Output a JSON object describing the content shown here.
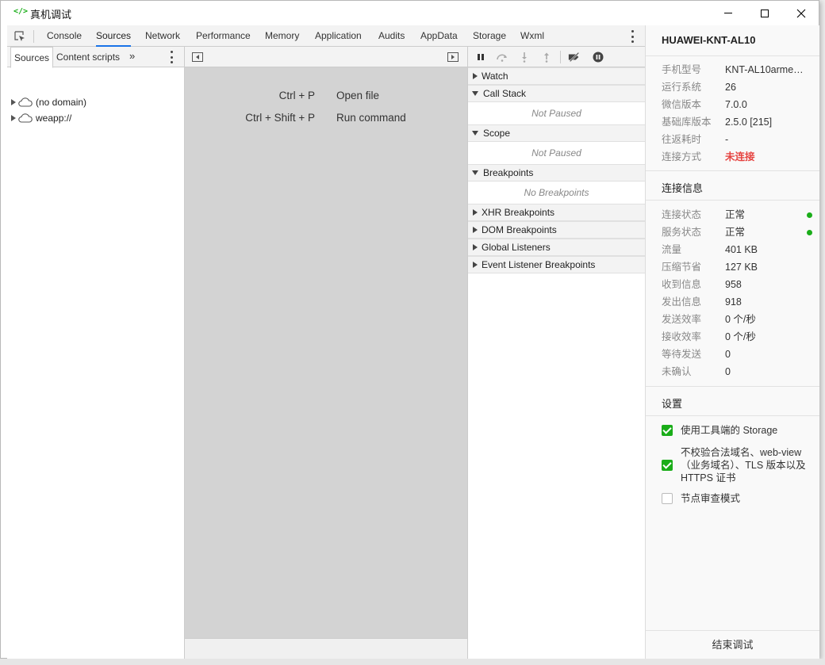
{
  "window": {
    "icon": "</>",
    "title": "真机调试",
    "icon_color": "#1aad19"
  },
  "tabs": [
    {
      "label": "Console"
    },
    {
      "label": "Sources",
      "active": true
    },
    {
      "label": "Network"
    },
    {
      "label": "Performance"
    },
    {
      "label": "Memory"
    },
    {
      "label": "Application"
    },
    {
      "label": "Audits"
    },
    {
      "label": "AppData"
    },
    {
      "label": "Storage"
    },
    {
      "label": "Wxml"
    }
  ],
  "navigator": {
    "tabs": [
      {
        "label": "Sources",
        "active": true
      },
      {
        "label": "Content scripts"
      }
    ],
    "more": "»",
    "tree": [
      {
        "label": "(no domain)",
        "icon": "cloud-icon"
      },
      {
        "label": "weapp://",
        "icon": "cloud-icon"
      }
    ]
  },
  "editor": {
    "shortcuts": [
      {
        "keys": "Ctrl + P",
        "action": "Open file"
      },
      {
        "keys": "Ctrl + Shift + P",
        "action": "Run command"
      }
    ]
  },
  "debugger": {
    "sections": [
      {
        "label": "Watch",
        "expanded": false
      },
      {
        "label": "Call Stack",
        "expanded": true,
        "body": "Not Paused"
      },
      {
        "label": "Scope",
        "expanded": true,
        "body": "Not Paused"
      },
      {
        "label": "Breakpoints",
        "expanded": true,
        "body": "No Breakpoints"
      },
      {
        "label": "XHR Breakpoints",
        "expanded": false
      },
      {
        "label": "DOM Breakpoints",
        "expanded": false
      },
      {
        "label": "Global Listeners",
        "expanded": false
      },
      {
        "label": "Event Listener Breakpoints",
        "expanded": false
      }
    ]
  },
  "info": {
    "device": "HUAWEI-KNT-AL10",
    "device_info": [
      {
        "label": "手机型号",
        "value": "KNT-AL10armea..."
      },
      {
        "label": "运行系统",
        "value": "26"
      },
      {
        "label": "微信版本",
        "value": "7.0.0"
      },
      {
        "label": "基础库版本",
        "value": "2.5.0 [215]"
      },
      {
        "label": "往返耗时",
        "value": "-"
      },
      {
        "label": "连接方式",
        "value": "未连接",
        "highlight": true
      }
    ],
    "conn_title": "连接信息",
    "conn_info": [
      {
        "label": "连接状态",
        "value": "正常",
        "dot": true
      },
      {
        "label": "服务状态",
        "value": "正常",
        "dot": true
      },
      {
        "label": "流量",
        "value": "401 KB"
      },
      {
        "label": "压缩节省",
        "value": "127 KB"
      },
      {
        "label": "收到信息",
        "value": "958"
      },
      {
        "label": "发出信息",
        "value": "918"
      },
      {
        "label": "发送效率",
        "value": "0 个/秒"
      },
      {
        "label": "接收效率",
        "value": "0 个/秒"
      },
      {
        "label": "等待发送",
        "value": "0"
      },
      {
        "label": "未确认",
        "value": "0"
      }
    ],
    "settings_title": "设置",
    "settings": [
      {
        "label": "使用工具端的 Storage",
        "checked": true
      },
      {
        "label": "不校验合法域名、web-view（业务域名）、TLS 版本以及 HTTPS 证书",
        "checked": true
      },
      {
        "label": "节点审查模式",
        "checked": false
      }
    ],
    "end_button": "结束调试",
    "status_color_ok": "#1aad19",
    "status_color_warn": "#e64340"
  }
}
